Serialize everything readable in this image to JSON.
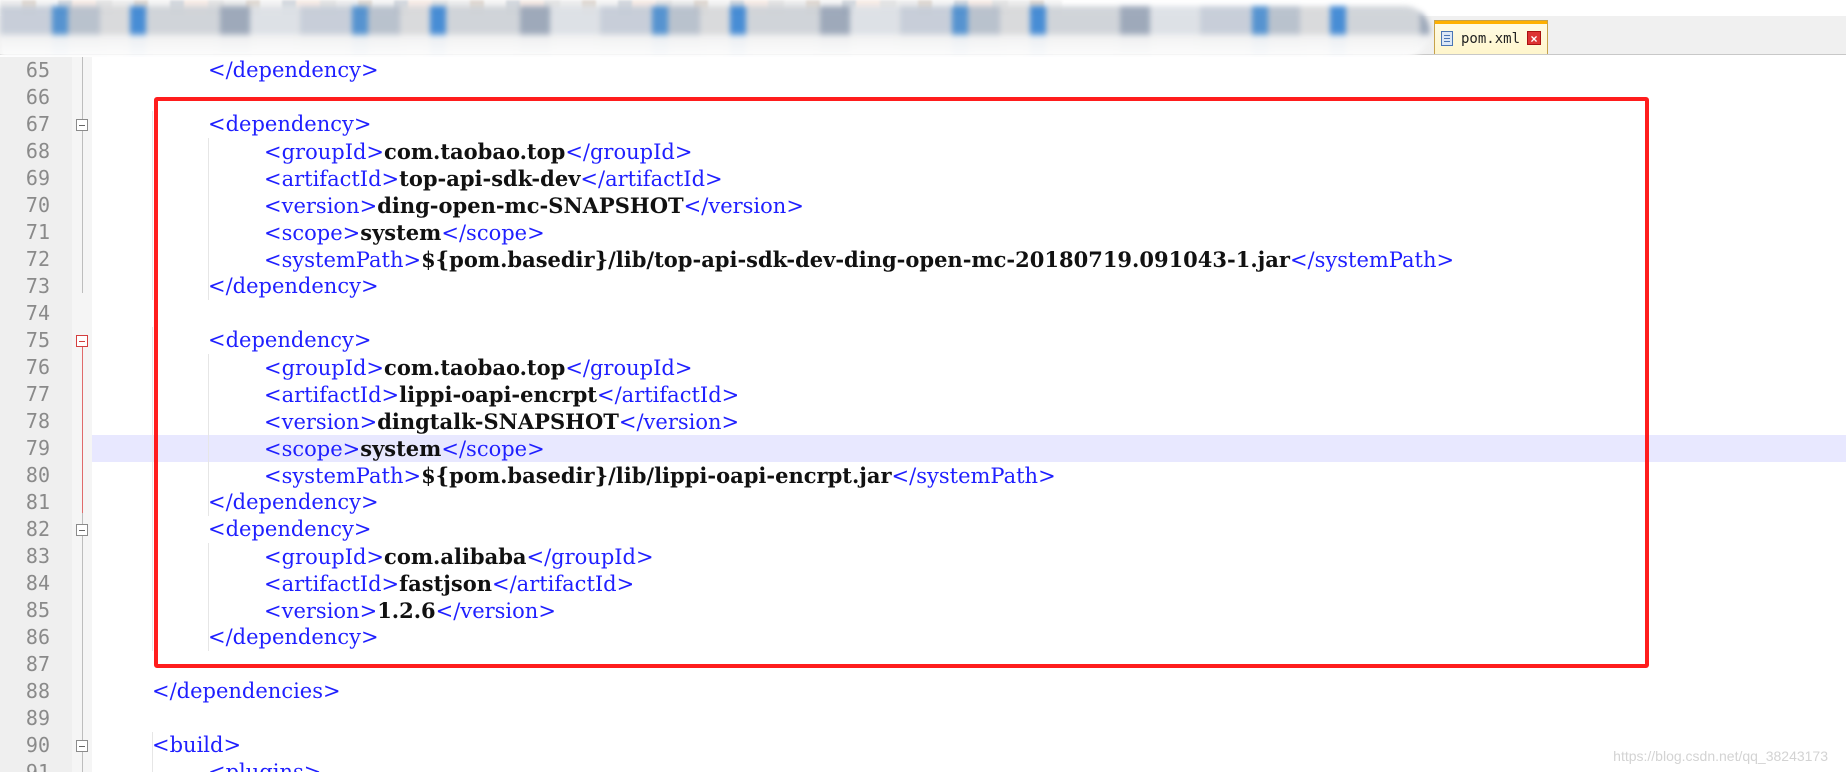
{
  "tabs": {
    "active_label": "pom.xml",
    "close_symbol": "×"
  },
  "lines": [
    {
      "number": "65",
      "indent": 2,
      "tag_open": "</dependency>",
      "value": "",
      "tag_close": ""
    },
    {
      "number": "66",
      "indent": 0,
      "tag_open": "",
      "value": "",
      "tag_close": ""
    },
    {
      "number": "67",
      "indent": 2,
      "tag_open": "<dependency>",
      "value": "",
      "tag_close": ""
    },
    {
      "number": "68",
      "indent": 3,
      "tag_open": "<groupId>",
      "value": "com.taobao.top",
      "tag_close": "</groupId>"
    },
    {
      "number": "69",
      "indent": 3,
      "tag_open": "<artifactId>",
      "value": "top-api-sdk-dev",
      "tag_close": "</artifactId>"
    },
    {
      "number": "70",
      "indent": 3,
      "tag_open": "<version>",
      "value": "ding-open-mc-SNAPSHOT",
      "tag_close": "</version>"
    },
    {
      "number": "71",
      "indent": 3,
      "tag_open": "<scope>",
      "value": "system",
      "tag_close": "</scope>"
    },
    {
      "number": "72",
      "indent": 3,
      "tag_open": "<systemPath>",
      "value": "${pom.basedir}/lib/top-api-sdk-dev-ding-open-mc-20180719.091043-1.jar",
      "tag_close": "</systemPath>"
    },
    {
      "number": "73",
      "indent": 2,
      "tag_open": "</dependency>",
      "value": "",
      "tag_close": ""
    },
    {
      "number": "74",
      "indent": 0,
      "tag_open": "",
      "value": "",
      "tag_close": ""
    },
    {
      "number": "75",
      "indent": 2,
      "tag_open": "<dependency>",
      "value": "",
      "tag_close": ""
    },
    {
      "number": "76",
      "indent": 3,
      "tag_open": "<groupId>",
      "value": "com.taobao.top",
      "tag_close": "</groupId>"
    },
    {
      "number": "77",
      "indent": 3,
      "tag_open": "<artifactId>",
      "value": "lippi-oapi-encrpt",
      "tag_close": "</artifactId>"
    },
    {
      "number": "78",
      "indent": 3,
      "tag_open": "<version>",
      "value": "dingtalk-SNAPSHOT",
      "tag_close": "</version>"
    },
    {
      "number": "79",
      "indent": 3,
      "tag_open": "<scope>",
      "value": "system",
      "tag_close": "</scope>"
    },
    {
      "number": "80",
      "indent": 3,
      "tag_open": "<systemPath>",
      "value": "${pom.basedir}/lib/lippi-oapi-encrpt.jar",
      "tag_close": "</systemPath>"
    },
    {
      "number": "81",
      "indent": 2,
      "tag_open": "</dependency>",
      "value": "",
      "tag_close": ""
    },
    {
      "number": "82",
      "indent": 2,
      "tag_open": "<dependency>",
      "value": "",
      "tag_close": ""
    },
    {
      "number": "83",
      "indent": 3,
      "tag_open": "<groupId>",
      "value": "com.alibaba",
      "tag_close": "</groupId>"
    },
    {
      "number": "84",
      "indent": 3,
      "tag_open": "<artifactId>",
      "value": "fastjson",
      "tag_close": "</artifactId>"
    },
    {
      "number": "85",
      "indent": 3,
      "tag_open": "<version>",
      "value": "1.2.6",
      "tag_close": "</version>"
    },
    {
      "number": "86",
      "indent": 2,
      "tag_open": "</dependency>",
      "value": "",
      "tag_close": ""
    },
    {
      "number": "87",
      "indent": 0,
      "tag_open": "",
      "value": "",
      "tag_close": ""
    },
    {
      "number": "88",
      "indent": 1,
      "tag_open": "</dependencies>",
      "value": "",
      "tag_close": ""
    },
    {
      "number": "89",
      "indent": 0,
      "tag_open": "",
      "value": "",
      "tag_close": ""
    },
    {
      "number": "90",
      "indent": 1,
      "tag_open": "<build>",
      "value": "",
      "tag_close": ""
    },
    {
      "number": "91",
      "indent": 2,
      "tag_open": "<plugins>",
      "value": "",
      "tag_close": ""
    }
  ],
  "current_line": "79",
  "watermark": "https://blog.csdn.net/qq_38243173",
  "colors": {
    "tag": "#1f1fff",
    "value": "#111111",
    "highlight": "#ff1d1d",
    "current_line": "#e8e8ff"
  }
}
